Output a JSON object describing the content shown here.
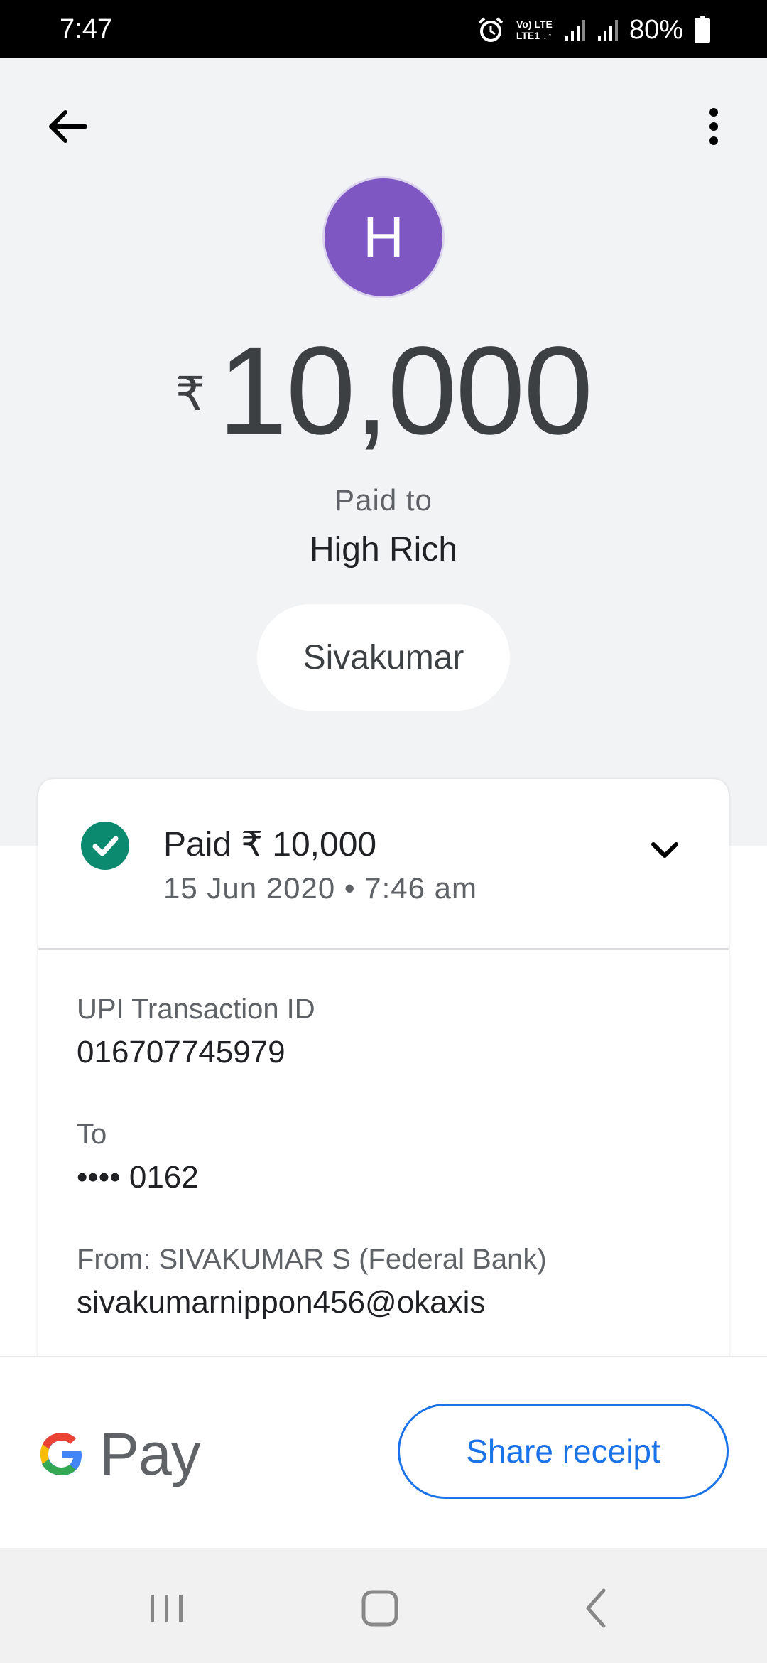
{
  "status_bar": {
    "time": "7:47",
    "lte_label": "Vo)) LTE LTE1 ↓↑",
    "battery": "80%"
  },
  "header": {
    "avatar_letter": "H",
    "currency": "₹",
    "amount": "10,000",
    "paid_to_label": "Paid to",
    "payee_name": "High Rich",
    "sender_chip": "Sivakumar"
  },
  "card": {
    "status_title": "Paid ₹ 10,000",
    "status_date": "15 Jun 2020 • 7:46 am",
    "upi_label": "UPI Transaction ID",
    "upi_value": "016707745979",
    "to_label": "To",
    "to_value": "•••• 0162",
    "from_label": "From: SIVAKUMAR S (Federal Bank)",
    "from_value": "sivakumarnippon456@okaxis"
  },
  "bottom": {
    "brand_text": "Pay",
    "share_label": "Share receipt"
  },
  "colors": {
    "avatar": "#7e57c2",
    "success": "#0b8a6f",
    "accent": "#1a73e8"
  }
}
